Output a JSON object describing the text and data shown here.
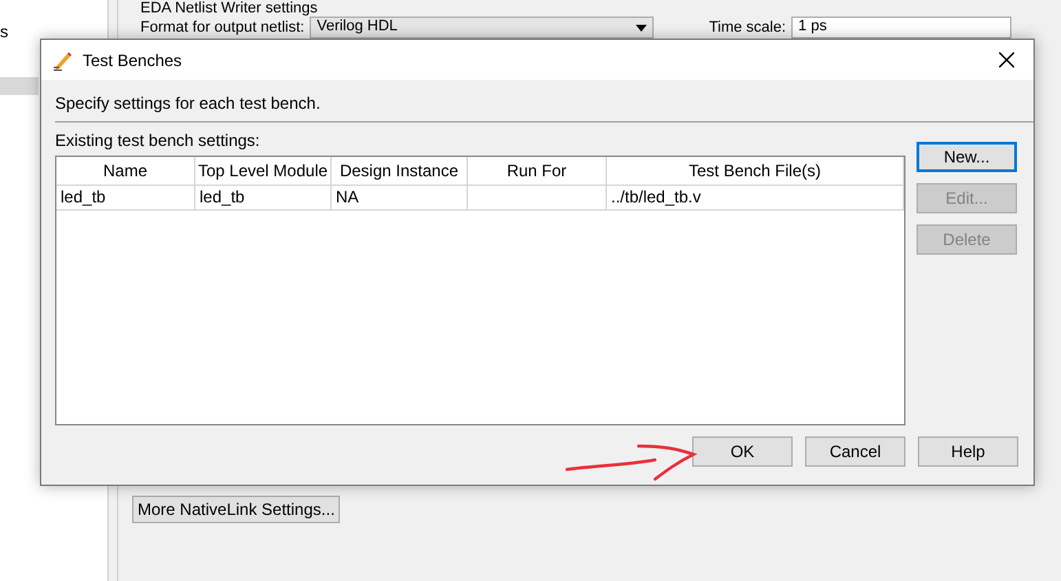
{
  "background": {
    "sidebar_text": "s",
    "group_title": "EDA Netlist Writer settings",
    "format_label": "Format for output netlist:",
    "format_value": "Verilog HDL",
    "time_scale_label": "Time scale:",
    "time_scale_value": "1 ps",
    "more_button": "More NativeLink Settings..."
  },
  "dialog": {
    "title": "Test Benches",
    "description": "Specify settings for each test bench.",
    "table_label": "Existing test bench settings:",
    "columns": [
      "Name",
      "Top Level Module",
      "Design Instance",
      "Run For",
      "Test Bench File(s)"
    ],
    "rows": [
      [
        "led_tb",
        "led_tb",
        "NA",
        "",
        "../tb/led_tb.v"
      ]
    ],
    "side_buttons": [
      {
        "label": "New...",
        "disabled": false,
        "focused": true
      },
      {
        "label": "Edit...",
        "disabled": true,
        "focused": false
      },
      {
        "label": "Delete",
        "disabled": true,
        "focused": false
      }
    ],
    "bottom_buttons": [
      {
        "label": "OK",
        "disabled": false
      },
      {
        "label": "Cancel",
        "disabled": false
      },
      {
        "label": "Help",
        "disabled": false
      }
    ]
  }
}
